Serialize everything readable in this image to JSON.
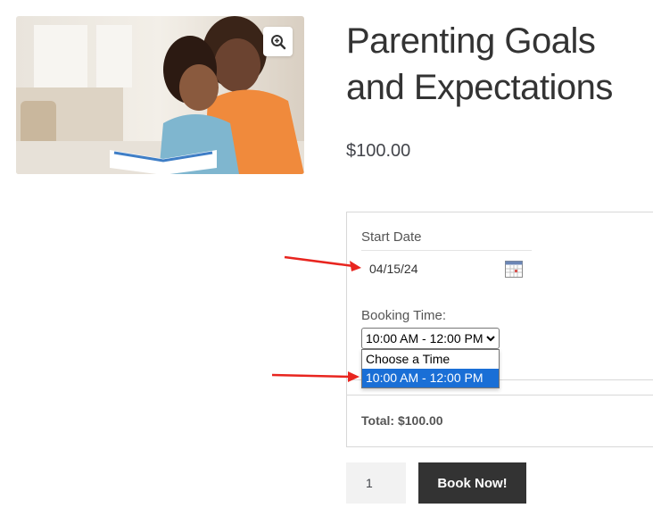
{
  "product": {
    "title": "Parenting Goals and Expectations",
    "price": "$100.00",
    "image_icon": "zoom-in-icon"
  },
  "booking": {
    "start_date_label": "Start Date",
    "start_date_value": "04/15/24",
    "time_label": "Booking Time:",
    "time_selected": "10:00 AM - 12:00 PM",
    "time_options": [
      "Choose a Time",
      "10:00 AM - 12:00 PM"
    ],
    "total": "Total: $100.00"
  },
  "cart": {
    "quantity": "1",
    "book_button": "Book Now!"
  },
  "colors": {
    "annotation_arrow": "#e8251f",
    "selected_option": "#1a6fd6",
    "button_bg": "#333333"
  }
}
